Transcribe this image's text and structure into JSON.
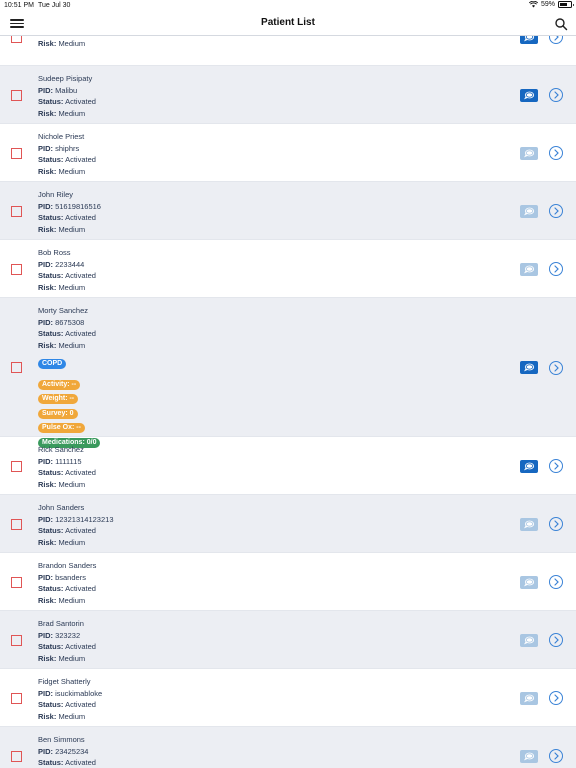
{
  "statusbar": {
    "time": "10:51 PM",
    "date": "Tue Jul 30",
    "battery": "59%",
    "battery_level": 0.59
  },
  "navbar": {
    "title": "Patient List"
  },
  "labels": {
    "pid": "PID:",
    "status": "Status:",
    "risk": "Risk:"
  },
  "patients": [
    {
      "name": "",
      "pid": "",
      "status": "Activated",
      "risk": "Medium",
      "chat_active": true,
      "partial": true
    },
    {
      "name": "Sudeep Pisipaty",
      "pid": "Malibu",
      "status": "Activated",
      "risk": "Medium",
      "chat_active": true
    },
    {
      "name": "Nichole Priest",
      "pid": "shiphrs",
      "status": "Activated",
      "risk": "Medium",
      "chat_active": false
    },
    {
      "name": "John Riley",
      "pid": "51619816516",
      "status": "Activated",
      "risk": "Medium",
      "chat_active": false
    },
    {
      "name": "Bob Ross",
      "pid": "2233444",
      "status": "Activated",
      "risk": "Medium",
      "chat_active": false
    },
    {
      "name": "Morty Sanchez",
      "pid": "8675308",
      "status": "Activated",
      "risk": "Medium",
      "chat_active": true,
      "condition": "COPD",
      "metrics": [
        "Activity: --",
        "Weight: --",
        "Survey: 0",
        "Pulse Ox: --"
      ],
      "medications": "Medications: 0/0"
    },
    {
      "name": "Rick Sanchez",
      "pid": "1111115",
      "status": "Activated",
      "risk": "Medium",
      "chat_active": true
    },
    {
      "name": "John Sanders",
      "pid": "12321314123213",
      "status": "Activated",
      "risk": "Medium",
      "chat_active": false
    },
    {
      "name": "Brandon Sanders",
      "pid": "bsanders",
      "status": "Activated",
      "risk": "Medium",
      "chat_active": false
    },
    {
      "name": "Brad Santorin",
      "pid": "323232",
      "status": "Activated",
      "risk": "Medium",
      "chat_active": false
    },
    {
      "name": "Fidget Shatterly",
      "pid": "isuckimabloke",
      "status": "Activated",
      "risk": "Medium",
      "chat_active": false
    },
    {
      "name": "Ben Simmons",
      "pid": "23425234",
      "status": "Activated",
      "risk": "Medium",
      "chat_active": false
    }
  ],
  "colors": {
    "accent": "#1667c0",
    "inactive_chat": "#a9c6e2",
    "checkbox": "#e05555",
    "tag_blue": "#2f87e6",
    "tag_orange": "#f0a73a",
    "tag_green": "#3a9a5d"
  }
}
